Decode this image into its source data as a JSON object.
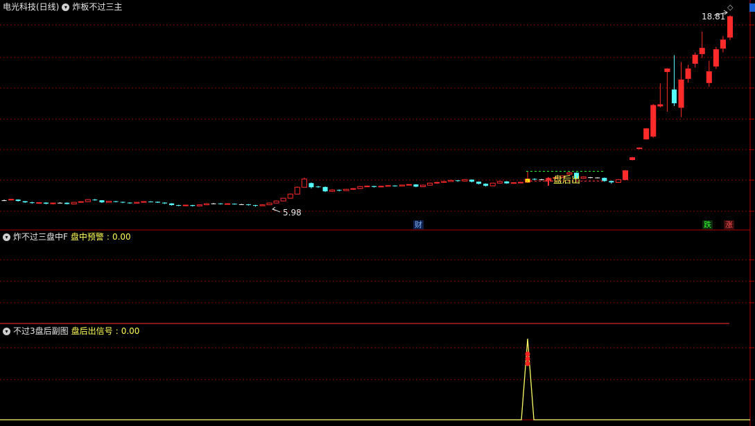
{
  "header": {
    "stock_name": "电光科技(日线)",
    "main_indicator": "炸板不过三主"
  },
  "panel2": {
    "title": "炸不过三盘中F",
    "label": "盘中预警",
    "value": "0.00"
  },
  "panel3": {
    "title": "不过3盘后副图",
    "label": "盘后出信号",
    "value": "0.00"
  },
  "price_labels": {
    "high": "18.81",
    "low": "5.98"
  },
  "signal_text": "盘后出",
  "tags": {
    "cai": "财",
    "die": "跌",
    "zhang": "涨"
  },
  "colors": {
    "up": "#ff2a2a",
    "down": "#55ffff",
    "grid": "#8b0000",
    "signal_line": "#ffff66",
    "flat": "#ffffff"
  },
  "chart_data": {
    "type": "candlestick",
    "ylim": [
      5.0,
      20.0
    ],
    "candles": [
      [
        6.45,
        6.45,
        6.5,
        6.4
      ],
      [
        6.48,
        6.52,
        6.56,
        6.44
      ],
      [
        6.5,
        6.4,
        6.52,
        6.36
      ],
      [
        6.38,
        6.3,
        6.4,
        6.26
      ],
      [
        6.3,
        6.26,
        6.34,
        6.2
      ],
      [
        6.25,
        6.28,
        6.3,
        6.22
      ],
      [
        6.28,
        6.2,
        6.3,
        6.16
      ],
      [
        6.2,
        6.25,
        6.28,
        6.15
      ],
      [
        6.25,
        6.27,
        6.3,
        6.22
      ],
      [
        6.27,
        6.18,
        6.29,
        6.15
      ],
      [
        6.18,
        6.3,
        6.33,
        6.16
      ],
      [
        6.3,
        6.35,
        6.38,
        6.28
      ],
      [
        6.35,
        6.5,
        6.53,
        6.33
      ],
      [
        6.5,
        6.45,
        6.55,
        6.42
      ],
      [
        6.45,
        6.3,
        6.46,
        6.25
      ],
      [
        6.3,
        6.38,
        6.4,
        6.28
      ],
      [
        6.38,
        6.33,
        6.4,
        6.3
      ],
      [
        6.33,
        6.28,
        6.35,
        6.24
      ],
      [
        6.28,
        6.24,
        6.3,
        6.2
      ],
      [
        6.24,
        6.3,
        6.33,
        6.22
      ],
      [
        6.3,
        6.36,
        6.38,
        6.28
      ],
      [
        6.36,
        6.34,
        6.38,
        6.31
      ],
      [
        6.34,
        6.28,
        6.36,
        6.26
      ],
      [
        6.28,
        6.22,
        6.3,
        6.18
      ],
      [
        6.22,
        6.1,
        6.24,
        6.06
      ],
      [
        6.1,
        6.06,
        6.13,
        6.02
      ],
      [
        6.06,
        6.1,
        6.12,
        6.02
      ],
      [
        6.1,
        6.04,
        6.12,
        6.0
      ],
      [
        6.04,
        6.12,
        6.15,
        6.02
      ],
      [
        6.12,
        6.2,
        6.24,
        6.1
      ],
      [
        6.2,
        6.22,
        6.25,
        6.16
      ],
      [
        6.22,
        6.17,
        6.24,
        6.14
      ],
      [
        6.17,
        6.2,
        6.22,
        6.14
      ],
      [
        6.2,
        6.16,
        6.22,
        6.13
      ],
      [
        6.16,
        6.15,
        6.19,
        6.12
      ],
      [
        6.15,
        6.1,
        6.18,
        6.06
      ],
      [
        6.1,
        6.05,
        6.12,
        5.98
      ],
      [
        6.05,
        6.12,
        6.15,
        6.03
      ],
      [
        6.12,
        6.25,
        6.28,
        6.1
      ],
      [
        6.25,
        6.4,
        6.43,
        6.23
      ],
      [
        6.4,
        6.6,
        6.62,
        6.38
      ],
      [
        6.6,
        6.9,
        6.95,
        6.58
      ],
      [
        6.9,
        7.4,
        7.45,
        6.88
      ],
      [
        7.4,
        8.0,
        8.1,
        7.38
      ],
      [
        7.7,
        7.4,
        7.75,
        7.3
      ],
      [
        7.45,
        7.42,
        7.5,
        7.35
      ],
      [
        7.42,
        7.1,
        7.45,
        7.05
      ],
      [
        7.1,
        7.2,
        7.25,
        7.05
      ],
      [
        7.2,
        7.15,
        7.24,
        7.1
      ],
      [
        7.15,
        7.25,
        7.28,
        7.12
      ],
      [
        7.25,
        7.3,
        7.34,
        7.2
      ],
      [
        7.3,
        7.45,
        7.48,
        7.28
      ],
      [
        7.45,
        7.48,
        7.52,
        7.4
      ],
      [
        7.48,
        7.42,
        7.5,
        7.38
      ],
      [
        7.42,
        7.47,
        7.5,
        7.4
      ],
      [
        7.47,
        7.52,
        7.55,
        7.44
      ],
      [
        7.52,
        7.48,
        7.54,
        7.44
      ],
      [
        7.48,
        7.56,
        7.6,
        7.46
      ],
      [
        7.56,
        7.6,
        7.63,
        7.52
      ],
      [
        7.6,
        7.44,
        7.62,
        7.4
      ],
      [
        7.44,
        7.55,
        7.6,
        7.42
      ],
      [
        7.55,
        7.7,
        7.73,
        7.52
      ],
      [
        7.7,
        7.75,
        7.8,
        7.65
      ],
      [
        7.75,
        7.82,
        7.86,
        7.72
      ],
      [
        7.82,
        7.9,
        7.95,
        7.8
      ],
      [
        7.9,
        7.85,
        7.92,
        7.8
      ],
      [
        7.85,
        7.95,
        7.98,
        7.82
      ],
      [
        7.95,
        7.8,
        7.96,
        7.75
      ],
      [
        7.8,
        7.65,
        7.82,
        7.6
      ],
      [
        7.65,
        7.5,
        7.68,
        7.45
      ],
      [
        7.5,
        7.7,
        7.73,
        7.48
      ],
      [
        7.7,
        7.82,
        7.86,
        7.68
      ],
      [
        7.82,
        7.68,
        7.84,
        7.65
      ],
      [
        7.68,
        7.73,
        7.76,
        7.65
      ],
      [
        7.73,
        7.76,
        7.8,
        7.7
      ],
      [
        7.76,
        8.0,
        8.55,
        7.72
      ],
      [
        8.0,
        7.97,
        8.05,
        7.9
      ],
      [
        7.97,
        7.95,
        8.0,
        7.9
      ],
      [
        7.95,
        8.05,
        8.08,
        7.92
      ],
      [
        8.05,
        8.1,
        8.13,
        8.02
      ],
      [
        8.1,
        8.22,
        8.25,
        8.08
      ],
      [
        8.35,
        8.45,
        8.5,
        8.3
      ],
      [
        8.45,
        8.05,
        8.48,
        8.0
      ],
      [
        8.05,
        8.15,
        8.18,
        8.02
      ],
      [
        8.12,
        8.1,
        8.14,
        8.05
      ],
      [
        8.1,
        8.08,
        8.12,
        8.05
      ],
      [
        8.08,
        7.85,
        8.1,
        7.8
      ],
      [
        7.85,
        7.75,
        7.88,
        7.65
      ],
      [
        7.75,
        7.95,
        7.98,
        7.72
      ],
      [
        7.95,
        8.6,
        8.65,
        7.95
      ],
      [
        9.4,
        9.55,
        9.6,
        9.35
      ],
      [
        10.2,
        10.25,
        10.3,
        10.15
      ],
      [
        10.9,
        11.65,
        11.7,
        10.85
      ],
      [
        11.1,
        13.35,
        13.45,
        11.0
      ],
      [
        13.3,
        13.4,
        14.95,
        13.2
      ],
      [
        15.8,
        16.0,
        16.05,
        12.9
      ],
      [
        14.5,
        13.5,
        17.0,
        13.3
      ],
      [
        13.2,
        15.2,
        16.5,
        12.5
      ],
      [
        15.3,
        16.0,
        16.3,
        15.0
      ],
      [
        16.4,
        17.0,
        17.2,
        16.1
      ],
      [
        17.1,
        17.5,
        18.7,
        16.8
      ],
      [
        15.0,
        15.8,
        16.6,
        14.7
      ],
      [
        16.2,
        17.4,
        17.6,
        16.0
      ],
      [
        17.5,
        18.1,
        18.4,
        17.2
      ],
      [
        18.3,
        19.8,
        19.9,
        18.1
      ]
    ]
  },
  "subchart_data": {
    "type": "line",
    "x_peak_index": 75,
    "values_peak": 1.0,
    "ylim": [
      0,
      1.2
    ]
  }
}
